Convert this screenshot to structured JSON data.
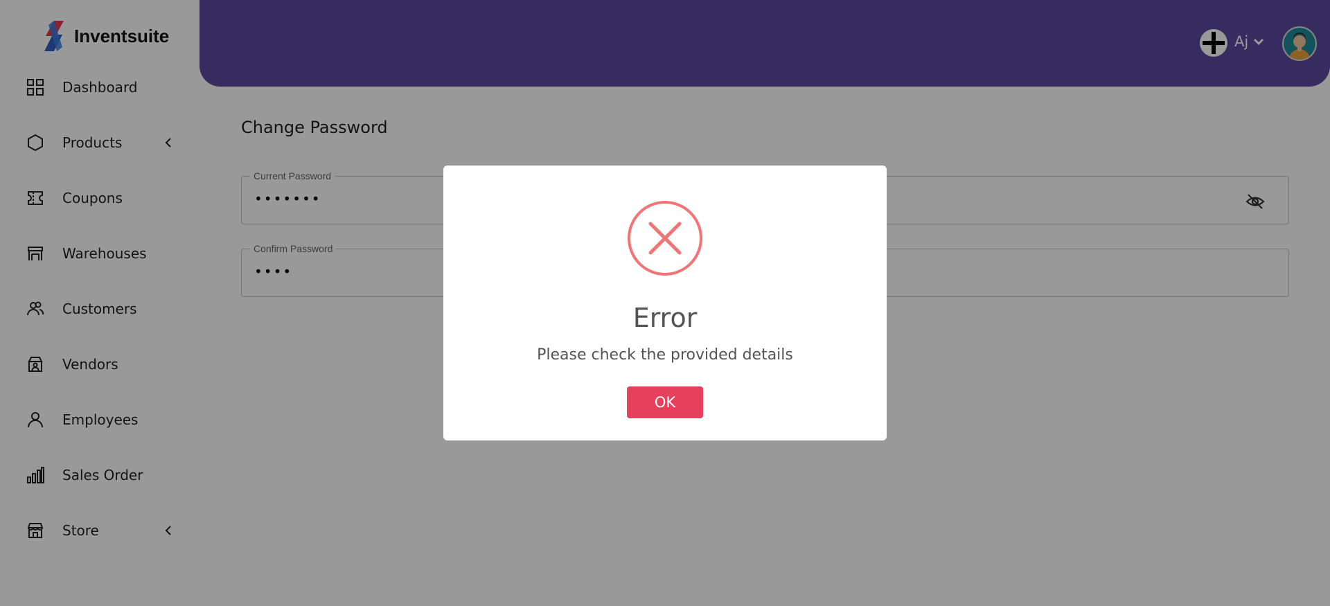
{
  "app": {
    "name": "Inventsuite"
  },
  "sidebar": {
    "items": [
      {
        "label": "Dashboard",
        "icon": "grid-icon",
        "has_submenu": false
      },
      {
        "label": "Products",
        "icon": "hexagon-icon",
        "has_submenu": true
      },
      {
        "label": "Coupons",
        "icon": "ticket-icon",
        "has_submenu": false
      },
      {
        "label": "Warehouses",
        "icon": "warehouse-icon",
        "has_submenu": false
      },
      {
        "label": "Customers",
        "icon": "users-icon",
        "has_submenu": false
      },
      {
        "label": "Vendors",
        "icon": "vendor-icon",
        "has_submenu": false
      },
      {
        "label": "Employees",
        "icon": "user-icon",
        "has_submenu": false
      },
      {
        "label": "Sales Order",
        "icon": "bar-chart-icon",
        "has_submenu": false
      },
      {
        "label": "Store",
        "icon": "store-icon",
        "has_submenu": true
      }
    ]
  },
  "header": {
    "user_name": "Aj",
    "accent_color": "#5a4a9e"
  },
  "main": {
    "title": "Change Password",
    "fields": [
      {
        "label": "Current Password",
        "value": "•••••••"
      },
      {
        "label": "Confirm Password",
        "value": "••••"
      }
    ]
  },
  "modal": {
    "title": "Error",
    "message": "Please check the provided details",
    "ok_label": "OK",
    "icon": "error-x-icon",
    "icon_color": "#f27474",
    "button_color": "#e7405c"
  }
}
